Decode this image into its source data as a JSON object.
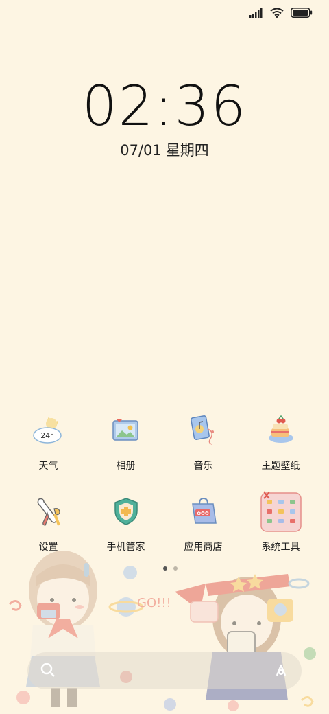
{
  "status_bar": {
    "icons": [
      "signal-icon",
      "wifi-icon",
      "battery-icon"
    ]
  },
  "lockscreen": {
    "time": "02:36",
    "date": "07/01",
    "weekday": "星期四"
  },
  "apps_row1": [
    {
      "label": "天气",
      "icon": "weather-icon",
      "badge": "24°"
    },
    {
      "label": "相册",
      "icon": "gallery-icon"
    },
    {
      "label": "音乐",
      "icon": "music-icon"
    },
    {
      "label": "主题壁纸",
      "icon": "themes-icon"
    }
  ],
  "apps_row2": [
    {
      "label": "设置",
      "icon": "settings-icon"
    },
    {
      "label": "手机管家",
      "icon": "security-icon"
    },
    {
      "label": "应用商店",
      "icon": "app-store-icon"
    },
    {
      "label": "系统工具",
      "icon": "tools-folder-icon"
    }
  ],
  "page_indicator": {
    "pages": 2,
    "current": 1
  },
  "dock": {
    "left_icon": "search-icon",
    "right_icon": "assistant-icon"
  },
  "wallpaper_text": "GO!!!",
  "colors": {
    "background": "#FDF5E3",
    "accent_red": "#E05A4F",
    "shield_green": "#4FB09A",
    "folder_pink": "#F6D5D3"
  }
}
